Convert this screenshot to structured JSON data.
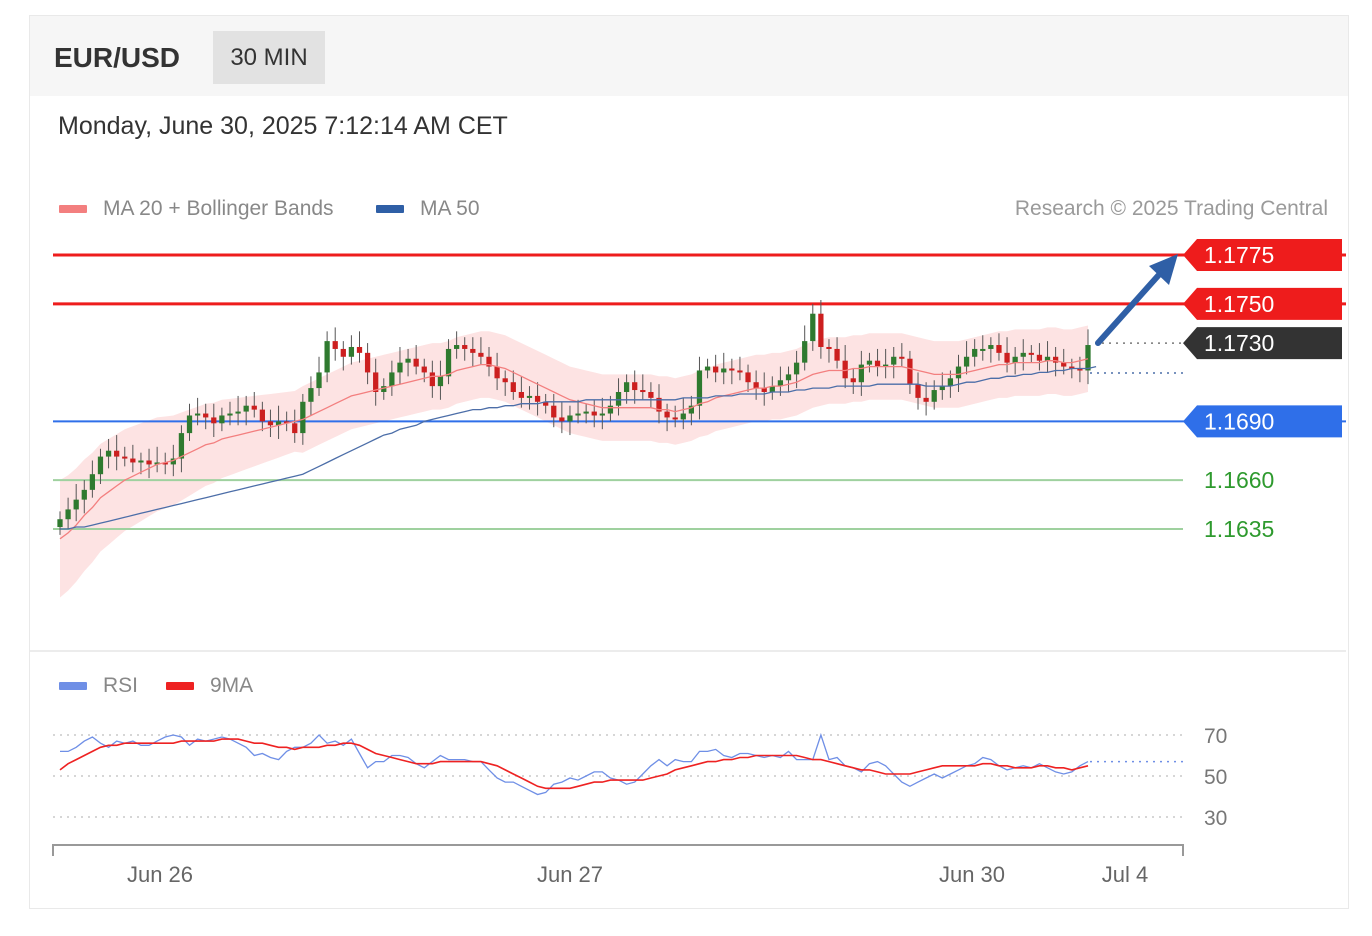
{
  "header": {
    "symbol": "EUR/USD",
    "timeframe": "30 MIN"
  },
  "datetime": "Monday, June 30, 2025 7:12:14 AM CET",
  "legend": {
    "ma20_label": "MA 20 + Bollinger Bands",
    "ma50_label": "MA 50",
    "rsi_label": "RSI",
    "rsi_ma_label": "9MA"
  },
  "copyright": "Research © 2025 Trading Central",
  "colors": {
    "resistance": "#ee1c1c",
    "support": "#2f6fe9",
    "target_line": "#9fd19f",
    "target_text": "#2e9a2e",
    "current": "#333333",
    "ma20": "#f37f7f",
    "ma50": "#4c6ea8",
    "bb_fill": "#fde3e3",
    "bull": "#2f7a2f",
    "bear": "#cc1f1f",
    "rsi": "#6f8fe6",
    "rsi_ma": "#ee2222",
    "arrow": "#2f5fa6"
  },
  "chart_data": [
    {
      "type": "candlestick",
      "title": "EUR/USD",
      "ylim": [
        1.159,
        1.1785
      ],
      "x_tick_labels": [
        "Jun 26",
        "Jun 27",
        "Jun 30",
        "Jul 4"
      ],
      "levels": [
        {
          "label": "1.1775",
          "value": 1.1775,
          "kind": "resistance"
        },
        {
          "label": "1.1750",
          "value": 1.175,
          "kind": "resistance"
        },
        {
          "label": "1.1730",
          "value": 1.173,
          "kind": "current"
        },
        {
          "label": "1.1690",
          "value": 1.169,
          "kind": "support"
        },
        {
          "label": "1.1660",
          "value": 1.166,
          "kind": "target"
        },
        {
          "label": "1.1635",
          "value": 1.1635,
          "kind": "target"
        }
      ],
      "close": [
        1.164,
        1.1645,
        1.165,
        1.1655,
        1.1663,
        1.1672,
        1.1675,
        1.1672,
        1.1671,
        1.1669,
        1.167,
        1.1668,
        1.1669,
        1.1668,
        1.1671,
        1.1684,
        1.1693,
        1.1694,
        1.1692,
        1.1689,
        1.1693,
        1.1694,
        1.1695,
        1.1698,
        1.1696,
        1.169,
        1.1688,
        1.169,
        1.1689,
        1.1684,
        1.17,
        1.1707,
        1.1715,
        1.1731,
        1.1727,
        1.1723,
        1.1728,
        1.1725,
        1.1715,
        1.1705,
        1.1708,
        1.1715,
        1.172,
        1.1722,
        1.1718,
        1.1715,
        1.1708,
        1.1713,
        1.1727,
        1.1729,
        1.1727,
        1.1725,
        1.1723,
        1.1718,
        1.1712,
        1.171,
        1.1705,
        1.1702,
        1.1703,
        1.17,
        1.1698,
        1.1692,
        1.169,
        1.1693,
        1.1694,
        1.1695,
        1.1693,
        1.1694,
        1.1698,
        1.1705,
        1.171,
        1.1706,
        1.1705,
        1.1702,
        1.1695,
        1.1692,
        1.1691,
        1.1694,
        1.1698,
        1.1716,
        1.1718,
        1.1715,
        1.1717,
        1.1716,
        1.1715,
        1.171,
        1.1707,
        1.1705,
        1.1708,
        1.1711,
        1.1714,
        1.172,
        1.1731,
        1.1745,
        1.1728,
        1.1727,
        1.1721,
        1.1712,
        1.171,
        1.1719,
        1.1721,
        1.1718,
        1.1719,
        1.1723,
        1.1722,
        1.1709,
        1.1702,
        1.17,
        1.1706,
        1.1708,
        1.1712,
        1.1718,
        1.1723,
        1.1727,
        1.1727,
        1.1729,
        1.1725,
        1.172,
        1.1723,
        1.1725,
        1.1724,
        1.1721,
        1.1723,
        1.172,
        1.1718,
        1.1717,
        1.1716,
        1.1729
      ],
      "ma20": [
        1.163,
        1.1633,
        1.1637,
        1.1642,
        1.1646,
        1.1651,
        1.1654,
        1.1657,
        1.166,
        1.1662,
        1.1664,
        1.1666,
        1.1668,
        1.1669,
        1.167,
        1.1672,
        1.1674,
        1.1676,
        1.1678,
        1.1679,
        1.1681,
        1.1682,
        1.1683,
        1.1684,
        1.1685,
        1.1686,
        1.1687,
        1.1688,
        1.1689,
        1.169,
        1.1691,
        1.1693,
        1.1695,
        1.1697,
        1.1699,
        1.1701,
        1.1703,
        1.1704,
        1.1705,
        1.1706,
        1.1707,
        1.1708,
        1.1709,
        1.171,
        1.1711,
        1.1712,
        1.1713,
        1.1713,
        1.1714,
        1.1716,
        1.1717,
        1.1718,
        1.1719,
        1.1719,
        1.1718,
        1.1717,
        1.1715,
        1.1713,
        1.1711,
        1.1709,
        1.1707,
        1.1705,
        1.1703,
        1.1701,
        1.17,
        1.1699,
        1.1698,
        1.1697,
        1.1697,
        1.1697,
        1.1697,
        1.1697,
        1.1697,
        1.1697,
        1.1696,
        1.1696,
        1.1695,
        1.1696,
        1.1697,
        1.1699,
        1.17,
        1.1702,
        1.1703,
        1.1704,
        1.1705,
        1.1706,
        1.1707,
        1.1707,
        1.1708,
        1.1708,
        1.1709,
        1.171,
        1.1712,
        1.1714,
        1.1715,
        1.1716,
        1.1716,
        1.1716,
        1.1717,
        1.1717,
        1.1718,
        1.1718,
        1.1718,
        1.1718,
        1.1718,
        1.1717,
        1.1716,
        1.1715,
        1.1714,
        1.1714,
        1.1714,
        1.1714,
        1.1715,
        1.1716,
        1.1717,
        1.1718,
        1.1719,
        1.1719,
        1.172,
        1.172,
        1.172,
        1.172,
        1.1721,
        1.1721,
        1.172,
        1.172,
        1.1721,
        1.1722
      ],
      "ma50": [
        1.1635,
        1.1635,
        1.1636,
        1.1636,
        1.1637,
        1.1638,
        1.1639,
        1.164,
        1.1641,
        1.1642,
        1.1643,
        1.1644,
        1.1645,
        1.1646,
        1.1647,
        1.1648,
        1.1649,
        1.165,
        1.1651,
        1.1652,
        1.1653,
        1.1654,
        1.1655,
        1.1656,
        1.1657,
        1.1658,
        1.1659,
        1.166,
        1.1661,
        1.1662,
        1.1663,
        1.1665,
        1.1667,
        1.1669,
        1.1671,
        1.1673,
        1.1675,
        1.1677,
        1.1679,
        1.1681,
        1.1683,
        1.1684,
        1.1686,
        1.1687,
        1.1688,
        1.169,
        1.1691,
        1.1692,
        1.1693,
        1.1694,
        1.1695,
        1.1696,
        1.1696,
        1.1697,
        1.1697,
        1.1698,
        1.1698,
        1.1699,
        1.1699,
        1.1699,
        1.17,
        1.17,
        1.17,
        1.17,
        1.17,
        1.1701,
        1.1701,
        1.1701,
        1.1701,
        1.1701,
        1.1701,
        1.1701,
        1.1701,
        1.1701,
        1.1701,
        1.1701,
        1.1701,
        1.1702,
        1.1702,
        1.1702,
        1.1702,
        1.1703,
        1.1703,
        1.1703,
        1.1704,
        1.1704,
        1.1704,
        1.1704,
        1.1705,
        1.1705,
        1.1705,
        1.1706,
        1.1706,
        1.1707,
        1.1707,
        1.1707,
        1.1708,
        1.1708,
        1.1708,
        1.1708,
        1.1708,
        1.1709,
        1.1709,
        1.1709,
        1.1709,
        1.1709,
        1.1709,
        1.1708,
        1.1708,
        1.1708,
        1.1708,
        1.1709,
        1.171,
        1.171,
        1.1711,
        1.1712,
        1.1712,
        1.1713,
        1.1713,
        1.1714,
        1.1714,
        1.1715,
        1.1715,
        1.1716,
        1.1716,
        1.1717,
        1.1717,
        1.1717,
        1.1718
      ]
    },
    {
      "type": "line",
      "title": "RSI",
      "ylim": [
        20,
        80
      ],
      "y_ticks": [
        70,
        50,
        30
      ],
      "series": [
        {
          "name": "RSI",
          "values": [
            62,
            62,
            64,
            67,
            69,
            66,
            64,
            67,
            66,
            67,
            65,
            65,
            67,
            69,
            70,
            69,
            65,
            68,
            67,
            68,
            69,
            68,
            66,
            64,
            60,
            61,
            59,
            58,
            62,
            64,
            64,
            66,
            70,
            66,
            67,
            65,
            68,
            61,
            54,
            57,
            57,
            60,
            60,
            59,
            56,
            54,
            57,
            60,
            58,
            58,
            58,
            57,
            57,
            53,
            49,
            47,
            47,
            45,
            43,
            41,
            42,
            46,
            47,
            49,
            48,
            50,
            52,
            52,
            49,
            48,
            46,
            47,
            51,
            55,
            58,
            55,
            58,
            57,
            57,
            62,
            62,
            63,
            60,
            59,
            61,
            61,
            60,
            59,
            60,
            59,
            62,
            58,
            58,
            58,
            70,
            58,
            59,
            55,
            54,
            52,
            56,
            57,
            55,
            51,
            47,
            45,
            47,
            49,
            51,
            49,
            51,
            53,
            55,
            56,
            59,
            58,
            55,
            53,
            54,
            55,
            54,
            56,
            54,
            52,
            51,
            52,
            55,
            57
          ]
        },
        {
          "name": "9MA",
          "values": [
            53,
            56,
            58,
            60,
            62,
            64,
            65,
            65,
            66,
            66,
            66,
            66,
            66,
            66,
            66,
            67,
            67,
            67,
            67,
            67,
            68,
            68,
            68,
            67,
            66,
            66,
            65,
            64,
            64,
            63,
            64,
            64,
            64,
            65,
            65,
            66,
            66,
            65,
            63,
            61,
            60,
            59,
            58,
            57,
            56,
            56,
            56,
            57,
            57,
            57,
            57,
            57,
            57,
            56,
            55,
            53,
            51,
            49,
            47,
            45,
            44,
            44,
            44,
            44,
            45,
            46,
            47,
            47,
            48,
            48,
            48,
            48,
            48,
            49,
            50,
            51,
            53,
            54,
            55,
            56,
            57,
            57,
            58,
            58,
            59,
            59,
            60,
            60,
            60,
            60,
            60,
            60,
            59,
            58,
            58,
            57,
            56,
            55,
            54,
            53,
            53,
            52,
            51,
            51,
            51,
            51,
            52,
            53,
            54,
            55,
            55,
            55,
            55,
            55,
            56,
            56,
            55,
            55,
            54,
            54,
            54,
            55,
            55,
            54,
            54,
            53,
            54,
            55
          ]
        }
      ]
    }
  ]
}
